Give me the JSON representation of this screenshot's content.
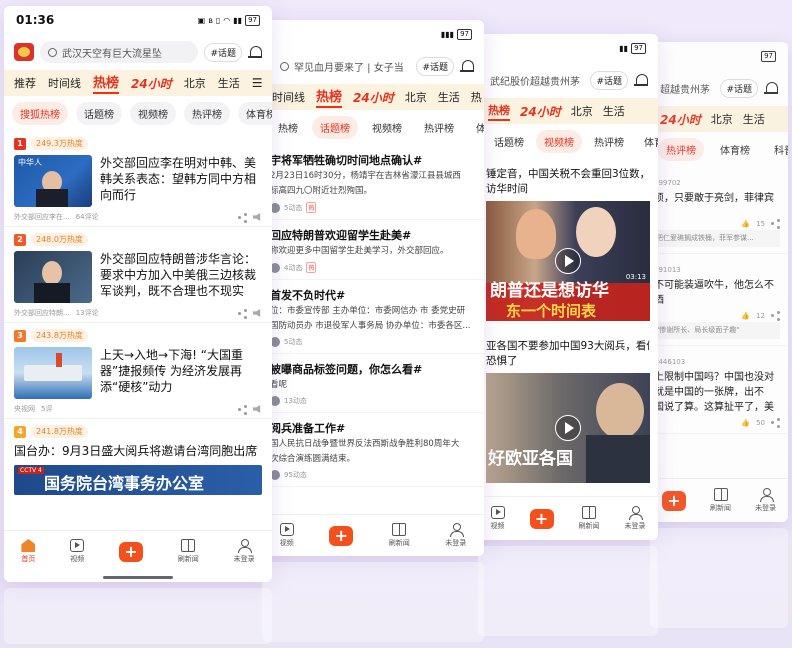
{
  "status": {
    "time": "01:36",
    "battery": "97"
  },
  "search": {
    "placeholder_main": "武汉天空有巨大流星坠",
    "placeholder_2": "罕见血月要来了 | 女子当",
    "placeholder_3": "武纪股价超越贵州茅",
    "placeholder_4": "超越贵州茅",
    "topic": "#话题"
  },
  "channels": {
    "items": [
      "推荐",
      "时间线",
      "热榜",
      "24小时",
      "北京",
      "生活"
    ],
    "short": [
      "时间线",
      "热榜",
      "24小时",
      "北京",
      "生活",
      "热"
    ],
    "short3": [
      "热榜",
      "24小时",
      "北京",
      "生活"
    ],
    "short4": [
      "24小时",
      "北京",
      "生活"
    ]
  },
  "subtabs": {
    "items": [
      "搜狐热榜",
      "话题榜",
      "视频榜",
      "热评榜",
      "体育榜"
    ],
    "s2": [
      "热榜",
      "话题榜",
      "视频榜",
      "热评榜",
      "体育榜"
    ],
    "s3": [
      "话题榜",
      "视频榜",
      "热评榜",
      "体育榜"
    ],
    "s4": [
      "热评榜",
      "体育榜",
      "科普榜"
    ]
  },
  "feed": [
    {
      "rank": "1",
      "heat": "249.3万热度",
      "title": "外交部回应李在明对中韩、美韩关系表态：望韩方同中方相向而行",
      "source": "外交部回应李在...",
      "comments": "64评论",
      "thumb_text": "中华人"
    },
    {
      "rank": "2",
      "heat": "248.0万热度",
      "title": "外交部回应特朗普涉华言论：要求中方加入中美俄三边核裁军谈判，既不合理也不现实",
      "source": "外交部回应特朗...",
      "comments": "13评论"
    },
    {
      "rank": "3",
      "heat": "243.8万热度",
      "title": "上天→入地→下海! “大国重器”捷报频传 为经济发展再添“硬核”动力",
      "source": "央视网",
      "comments": "5评"
    },
    {
      "rank": "4",
      "heat": "241.8万热度",
      "title": "国台办：9月3日盛大阅兵将邀请台湾同胞出席",
      "banner": "国务院台湾事务办公室",
      "banner_tag": "CCTV 4"
    }
  ],
  "nav": {
    "home": "首页",
    "video": "视频",
    "refresh": "刷新闻",
    "login": "未登录"
  },
  "screen2": [
    {
      "title": "宇将军牺牲确切时间地点确认#",
      "desc1": "2月23日16时30分，杨靖宇在吉林省濛江县县城西",
      "desc2": "标高四九〇附近壮烈殉国。",
      "meta": "5动态",
      "hot": "热"
    },
    {
      "title": "回应特朗普欢迎留学生赴美#",
      "desc1": "称欢迎更多中国留学生赴美学习，外交部回应。",
      "meta": "4动态",
      "hot": "热"
    },
    {
      "title": "首发不负时代#",
      "desc1": "位：市委宣传部 主办单位：市委网信办 市 委党史研",
      "desc2": "国防动员办 市退役军人事务局 协办单位：市委各区...",
      "meta": "5动态"
    },
    {
      "title": "被曝商品标签问题，你怎么看#",
      "desc1": "看呢",
      "meta": "13动态"
    },
    {
      "title": "阅兵准备工作#",
      "desc1": "国人民抗日战争暨世界反法西斯战争胜利80周年大",
      "desc2": "次综合演练圆满结束。",
      "meta": "95动态"
    }
  ],
  "screen3": [
    {
      "title": "锤定音，中国关税不会重回3位数，",
      "title2": "访华时间",
      "caption": "朗普还是想访华",
      "caption2": "东一个时间表",
      "duration": "03:13"
    },
    {
      "title": "亚各国不要参加中国93大阅兵，看似",
      "title2": "恐惧了",
      "caption": "好欧亚各国"
    }
  ],
  "screen4": [
    {
      "num": "899702",
      "title": "烦，只要敢于亮剑，菲律宾",
      "likes": "15",
      "quote": "把仁爱礁搁成铁桶，菲军参谋..."
    },
    {
      "num": "691013",
      "title": "不可能装逼吹牛，他怎么不",
      "title2": "酒",
      "likes": "12",
      "quote": "\"惨谢所长、局长级面子趣\""
    },
    {
      "num": "1446103",
      "title": "上限制中国吗？中国也没对",
      "title2": "就是中国的一张牌，出不",
      "title3": "国说了算。这算扯平了，美",
      "likes": "50"
    }
  ]
}
